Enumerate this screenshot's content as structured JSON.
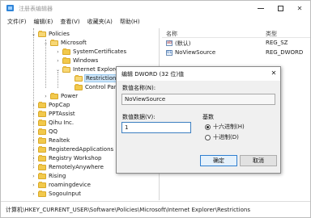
{
  "window": {
    "title": "注册表编辑器",
    "icon": "regedit-icon",
    "controls": {
      "minimize": "—",
      "maximize": "□",
      "close": "✕"
    }
  },
  "menu": [
    "文件(F)",
    "编辑(E)",
    "查看(V)",
    "收藏夹(A)",
    "帮助(H)"
  ],
  "tree": {
    "items": [
      {
        "label": "Policies",
        "state": "expanded"
      },
      {
        "label": "Microsoft",
        "state": "expanded"
      },
      {
        "label": "SystemCertificates",
        "state": "collapsed"
      },
      {
        "label": "Windows",
        "state": "collapsed"
      },
      {
        "label": "Internet Explorer",
        "state": "expanded"
      },
      {
        "label": "Restrictions",
        "state": "selected"
      },
      {
        "label": "Control Panel",
        "state": "leaf"
      },
      {
        "label": "Power",
        "state": "collapsed"
      },
      {
        "label": "PopCap",
        "state": "collapsed"
      },
      {
        "label": "PPTAssist",
        "state": "collapsed"
      },
      {
        "label": "Qihu Inc.",
        "state": "collapsed"
      },
      {
        "label": "QQ",
        "state": "collapsed"
      },
      {
        "label": "Realtek",
        "state": "collapsed"
      },
      {
        "label": "RegisteredApplications",
        "state": "collapsed"
      },
      {
        "label": "Registry Workshop",
        "state": "collapsed"
      },
      {
        "label": "RemotelyAnywhere",
        "state": "collapsed"
      },
      {
        "label": "Rising",
        "state": "collapsed"
      },
      {
        "label": "roamingdevice",
        "state": "collapsed"
      },
      {
        "label": "SogouInput",
        "state": "collapsed"
      }
    ]
  },
  "values_list": {
    "col_name": "名称",
    "col_type": "类型",
    "rows": [
      {
        "name": "(默认)",
        "type": "REG_SZ",
        "icon": "ab"
      },
      {
        "name": "NoViewSource",
        "type": "REG_DWORD",
        "icon": "bin"
      }
    ]
  },
  "status_path": "计算机\\HKEY_CURRENT_USER\\Software\\Policies\\Microsoft\\Internet Explorer\\Restrictions",
  "dialog": {
    "title": "编辑 DWORD (32 位)值",
    "close": "✕",
    "value_name_label": "数值名称(N):",
    "value_name": "NoViewSource",
    "value_data_label": "数值数据(V):",
    "value_data": "1",
    "base_label": "基数",
    "base_options": [
      {
        "label": "十六进制(H)",
        "checked": true
      },
      {
        "label": "十进制(D)",
        "checked": false
      }
    ],
    "ok_label": "确定",
    "cancel_label": "取消"
  },
  "colors": {
    "selection": "#cce4f7",
    "folder": "#f2c94c",
    "primary_button_border": "#2f7fd0"
  }
}
